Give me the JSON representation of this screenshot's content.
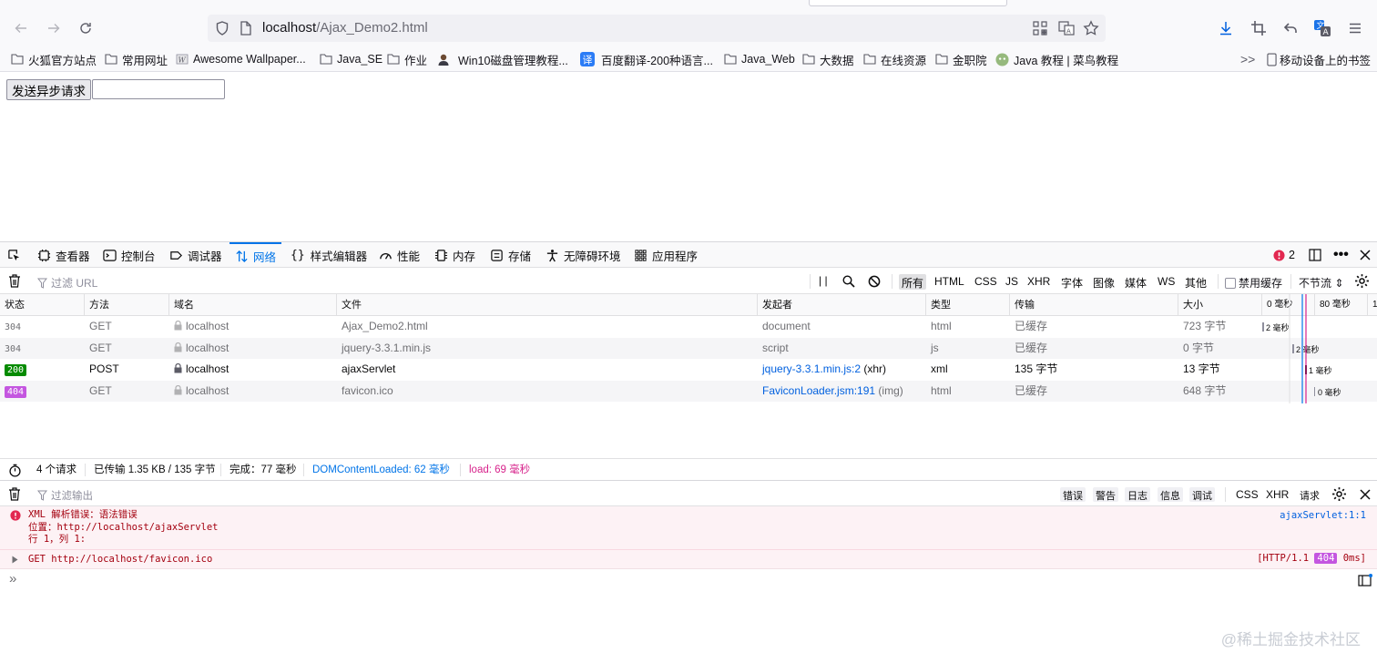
{
  "browser": {
    "url_host": "localhost",
    "url_path": "/Ajax_Demo2.html"
  },
  "bookmarks": [
    {
      "label": "火狐官方站点",
      "icon": "folder-icon"
    },
    {
      "label": "常用网址",
      "icon": "folder-icon"
    },
    {
      "label": "Awesome Wallpaper...",
      "icon": "wallpaper-favicon"
    },
    {
      "label": "Java_SE",
      "icon": "folder-icon"
    },
    {
      "label": "作业",
      "icon": "folder-icon"
    },
    {
      "label": "Win10磁盘管理教程...",
      "icon": "person-favicon"
    },
    {
      "label": "百度翻译-200种语言...",
      "icon": "translate-favicon"
    },
    {
      "label": "Java_Web",
      "icon": "folder-icon"
    },
    {
      "label": "大数据",
      "icon": "folder-icon"
    },
    {
      "label": "在线资源",
      "icon": "folder-icon"
    },
    {
      "label": "金职院",
      "icon": "folder-icon"
    },
    {
      "label": "Java 教程 | 菜鸟教程",
      "icon": "runoob-favicon"
    }
  ],
  "bookmarks_overflow": ">>",
  "mobile_bookmarks": "移动设备上的书签",
  "page": {
    "send_button": "发送异步请求",
    "input_value": ""
  },
  "devtools": {
    "tabs": [
      {
        "label": "查看器",
        "icon": "inspector-icon"
      },
      {
        "label": "控制台",
        "icon": "console-icon"
      },
      {
        "label": "调试器",
        "icon": "debugger-icon"
      },
      {
        "label": "网络",
        "icon": "network-icon"
      },
      {
        "label": "样式编辑器",
        "icon": "style-editor-icon"
      },
      {
        "label": "性能",
        "icon": "performance-icon"
      },
      {
        "label": "内存",
        "icon": "memory-icon"
      },
      {
        "label": "存储",
        "icon": "storage-icon"
      },
      {
        "label": "无障碍环境",
        "icon": "accessibility-icon"
      },
      {
        "label": "应用程序",
        "icon": "application-icon"
      }
    ],
    "active_tab": "网络",
    "error_count": "2",
    "network": {
      "filter_placeholder": "过滤 URL",
      "types": [
        "所有",
        "HTML",
        "CSS",
        "JS",
        "XHR",
        "字体",
        "图像",
        "媒体",
        "WS",
        "其他"
      ],
      "selected_type": "所有",
      "disable_cache": "禁用缓存",
      "throttle": "不节流 ⇕",
      "columns": [
        "状态",
        "方法",
        "域名",
        "文件",
        "发起者",
        "类型",
        "传输",
        "大小",
        "0 毫秒",
        "80 毫秒",
        "1"
      ],
      "rows": [
        {
          "status": "304",
          "method": "GET",
          "domain": "localhost",
          "file": "Ajax_Demo2.html",
          "initiator": "document",
          "initiator_suffix": "",
          "type": "html",
          "transferred": "已缓存",
          "size": "723 字节",
          "timing": "2 毫秒"
        },
        {
          "status": "304",
          "method": "GET",
          "domain": "localhost",
          "file": "jquery-3.3.1.min.js",
          "initiator": "script",
          "initiator_suffix": "",
          "type": "js",
          "transferred": "已缓存",
          "size": "0 字节",
          "timing": "2 毫秒"
        },
        {
          "status": "200",
          "method": "POST",
          "domain": "localhost",
          "file": "ajaxServlet",
          "initiator": "jquery-3.3.1.min.js:2",
          "initiator_suffix": " (xhr)",
          "type": "xml",
          "transferred": "135 字节",
          "size": "13 字节",
          "timing": "1 毫秒"
        },
        {
          "status": "404",
          "method": "GET",
          "domain": "localhost",
          "file": "favicon.ico",
          "initiator": "FaviconLoader.jsm:191",
          "initiator_suffix": " (img)",
          "type": "html",
          "transferred": "已缓存",
          "size": "648 字节",
          "timing": "0 毫秒"
        }
      ],
      "summary": {
        "requests": "4 个请求",
        "transferred": "已传输 1.35 KB / 135 字节",
        "finish": "完成：77 毫秒",
        "dom_loaded": "DOMContentLoaded: 62 毫秒",
        "load": "load: 69 毫秒"
      }
    },
    "console": {
      "filter_placeholder": "过滤输出",
      "level_filters": [
        "错误",
        "警告",
        "日志",
        "信息",
        "调试"
      ],
      "other_filters": [
        "CSS",
        "XHR",
        "请求"
      ],
      "messages": [
        {
          "line1": "XML 解析错误：语法错误",
          "line2": "位置：http://localhost/ajaxServlet",
          "line3": "行 1，列 1:",
          "source": "ajaxServlet:1:1"
        },
        {
          "text": "GET http://localhost/favicon.ico",
          "http_prefix": "[HTTP/1.1 ",
          "http_status": "404",
          "http_time": " 0ms]"
        }
      ],
      "prompt": "»"
    }
  },
  "colors": {
    "accent": "#0074e8",
    "status_200": "#058b00",
    "status_404": "#c456e0",
    "dom_loaded": "#0074e8",
    "load": "#d7228b",
    "error_text": "#a4000f"
  },
  "watermark": "@稀土掘金技术社区"
}
